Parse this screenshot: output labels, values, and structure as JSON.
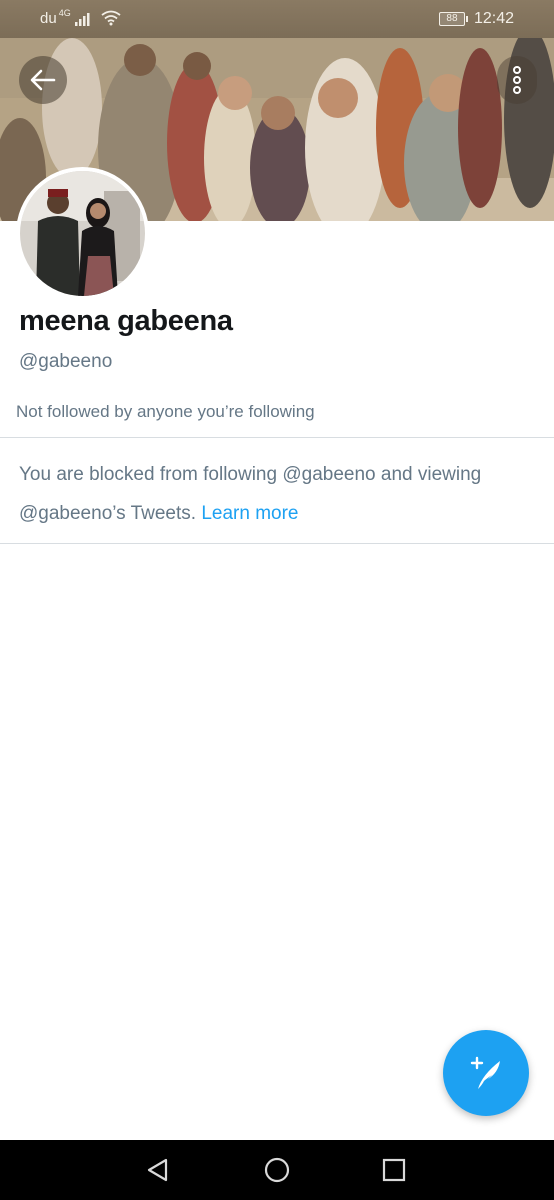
{
  "status_bar": {
    "carrier": "du",
    "network_type": "4G",
    "battery": "88",
    "time": "12:42"
  },
  "profile": {
    "display_name": "meena gabeena",
    "username": "@gabeeno",
    "followed_by": "Not followed by anyone you’re following"
  },
  "blocked_notice": {
    "text": "You are blocked from following @gabeeno and viewing @gabeeno’s Tweets.",
    "link": "Learn more"
  },
  "colors": {
    "accent": "#1da1f2",
    "secondary_text": "#657786",
    "status_bar": "#7c6d57"
  },
  "icons": {
    "back": "arrow-left-icon",
    "more": "vertical-dots-icon",
    "compose": "feather-plus-icon",
    "nav_back": "triangle-back-icon",
    "nav_home": "circle-home-icon",
    "nav_recents": "square-recents-icon"
  }
}
